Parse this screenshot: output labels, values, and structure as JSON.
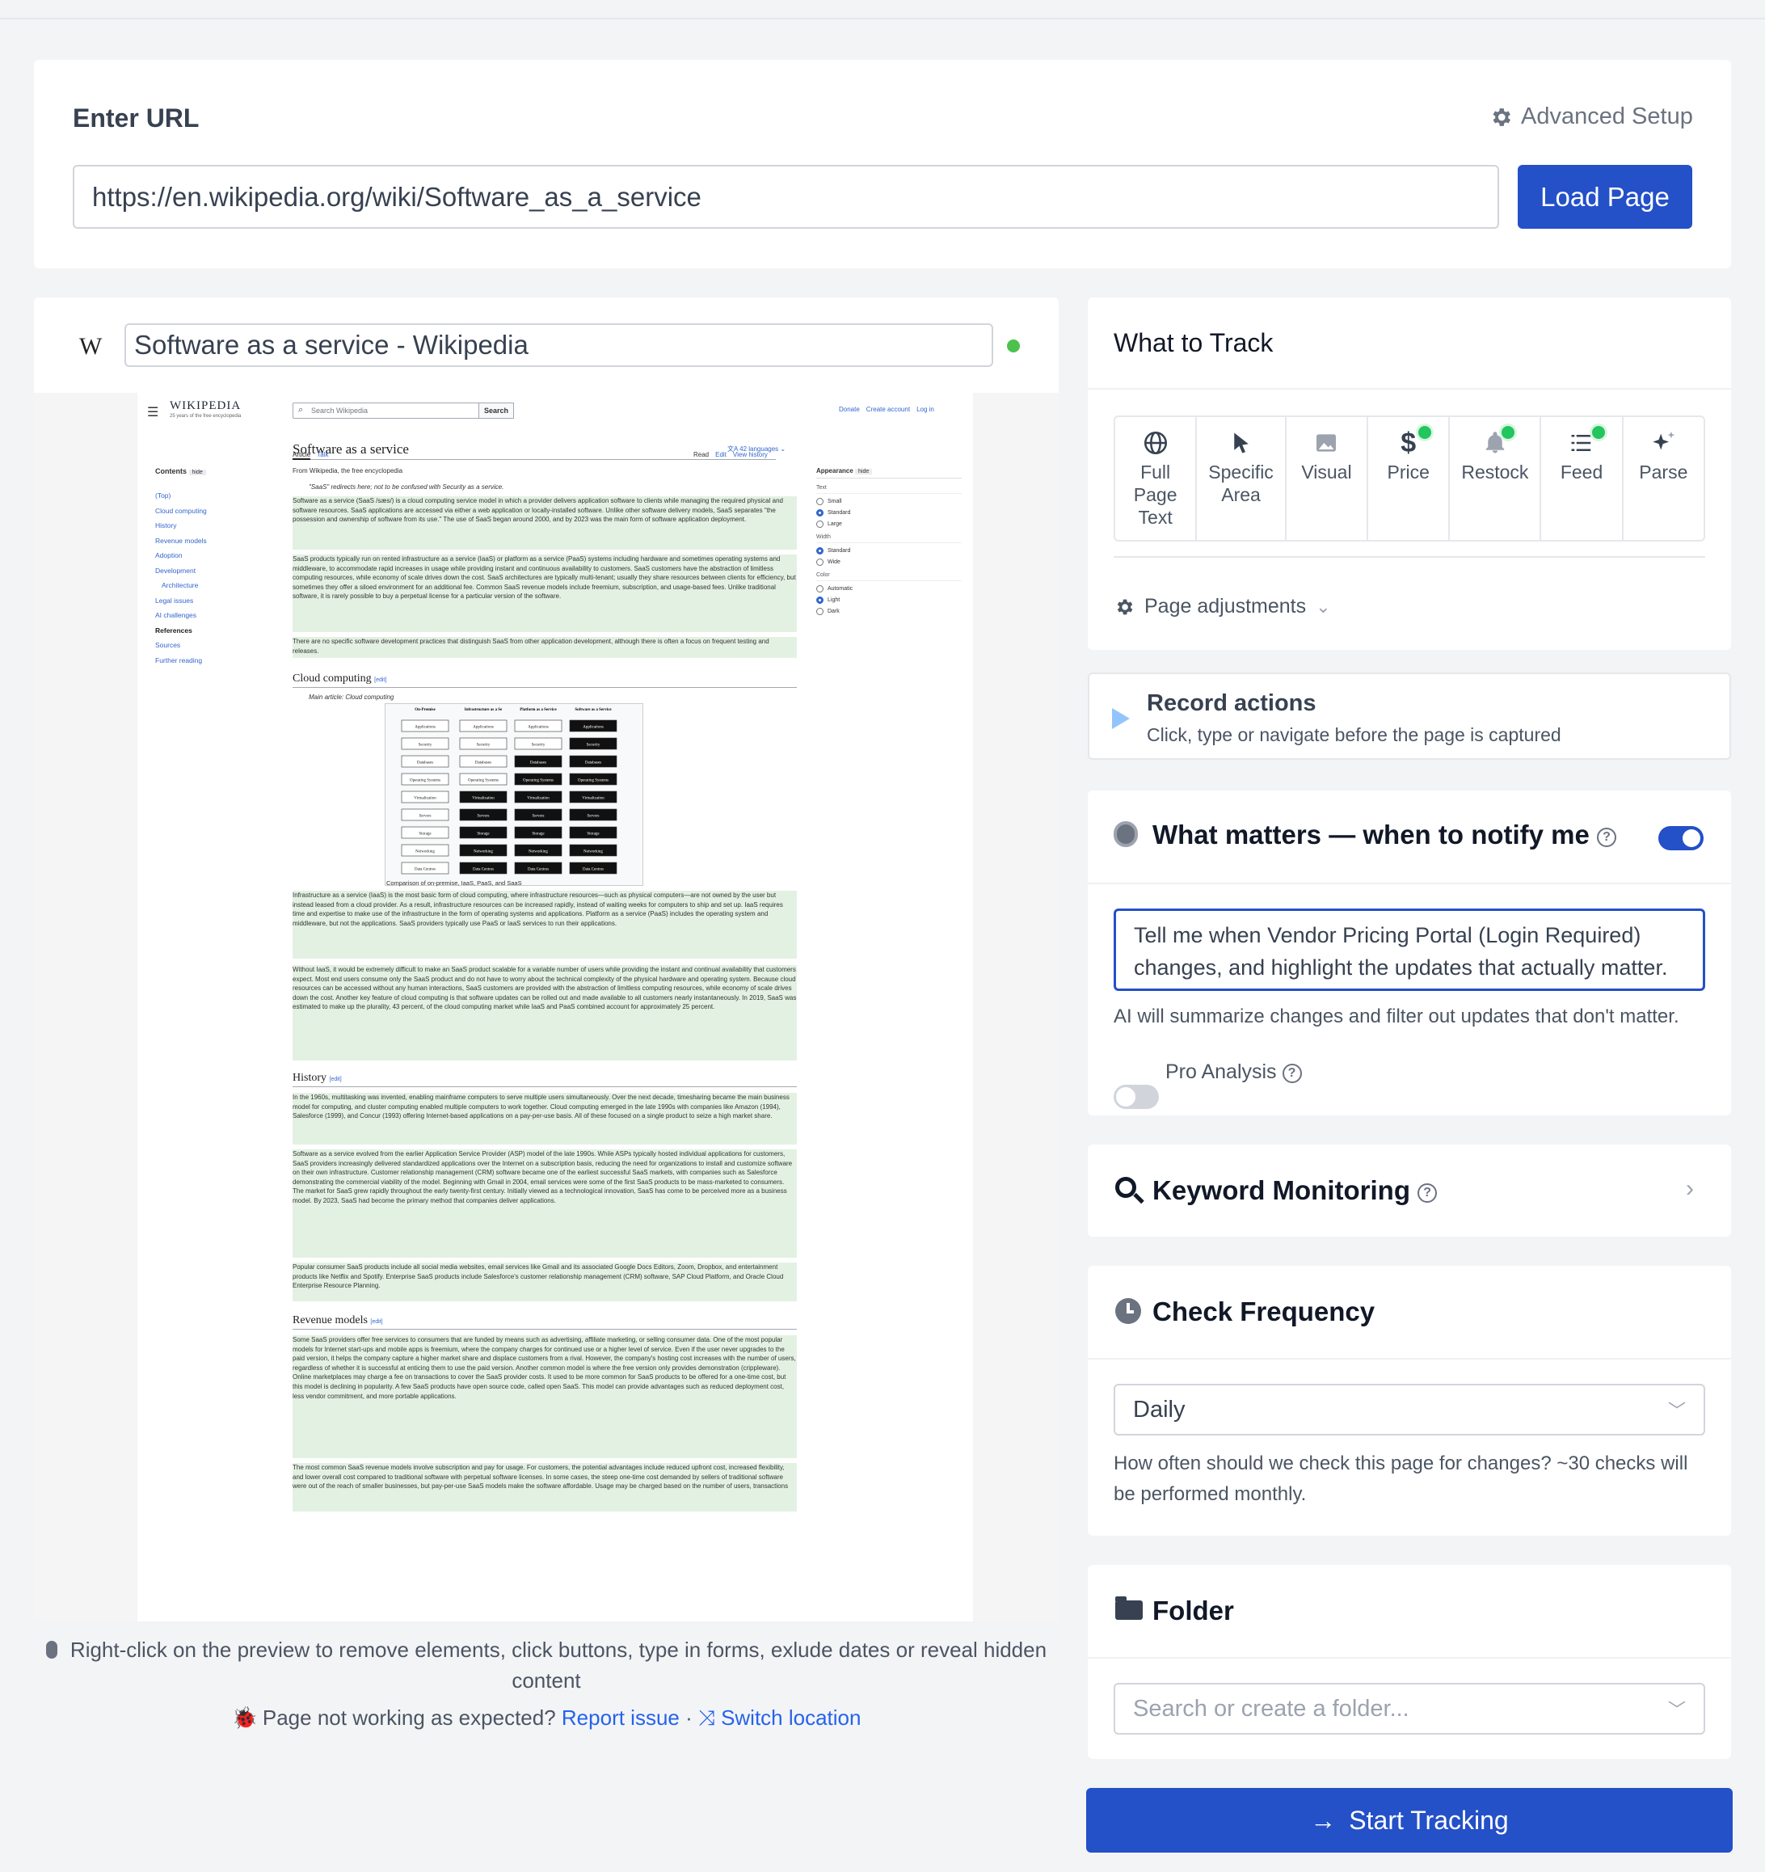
{
  "url_card": {
    "label": "Enter URL",
    "advanced_setup": "Advanced Setup",
    "url_value": "https://en.wikipedia.org/wiki/Software_as_a_service",
    "load_button": "Load Page"
  },
  "preview": {
    "site_icon": "W",
    "page_title": "Software as a service - Wikipedia",
    "status_color": "#4cc24c",
    "wiki": {
      "logo": "WIKIPEDIA",
      "logo_sub": "25 years of the free encyclopedia",
      "search_placeholder": "Search Wikipedia",
      "search_button": "Search",
      "top_links": [
        "Donate",
        "Create account",
        "Log in"
      ],
      "contents_label": "Contents",
      "hide": "hide",
      "toc": [
        "(Top)",
        "Cloud computing",
        "History",
        "Revenue models",
        "Adoption",
        "Development",
        "Architecture",
        "Legal issues",
        "AI challenges",
        "References",
        "Sources",
        "Further reading"
      ],
      "article_title": "Software as a service",
      "languages": "42 languages",
      "tabs_left": [
        "Article",
        "Talk"
      ],
      "tabs_right": [
        "Read",
        "Edit",
        "View history"
      ],
      "from": "From Wikipedia, the free encyclopedia",
      "hatnote": "\"SaaS\" redirects here; not to be confused with Security as a service.",
      "appearance_label": "Appearance",
      "appearance_groups": [
        {
          "name": "Text",
          "options": [
            "Small",
            "Standard",
            "Large"
          ],
          "selected": 1
        },
        {
          "name": "Width",
          "options": [
            "Standard",
            "Wide"
          ],
          "selected": 0
        },
        {
          "name": "Color",
          "options": [
            "Automatic",
            "Light",
            "Dark"
          ],
          "selected": 1
        }
      ],
      "sections": [
        "Cloud computing",
        "History",
        "Revenue models"
      ],
      "edit": "edit",
      "main_article": "Main article: Cloud computing",
      "diagram_caption": "Comparison of on-premise, IaaS, PaaS, and SaaS",
      "diagram_cols": [
        "On-Premise",
        "Infrastructure as a Service (IaaS)",
        "Platform as a Service (PaaS)",
        "Software as a Service (SaaS)"
      ],
      "diagram_rows": [
        "Applications",
        "Security",
        "Databases",
        "Operating Systems",
        "Virtualization",
        "Servers",
        "Storage",
        "Networking",
        "Data Centres"
      ],
      "intro_p": "Software as a service (SaaS /sæs/) is a cloud computing service model in which a provider delivers application software to clients while managing the required physical and software resources. SaaS applications are accessed via either a web application or locally-installed software. Unlike other software delivery models, SaaS separates \"the possession and ownership of software from its use.\" The use of SaaS began around 2000, and by 2023 was the main form of software application deployment.",
      "p2": "SaaS products typically run on rented infrastructure as a service (IaaS) or platform as a service (PaaS) systems including hardware and sometimes operating systems and middleware, to accommodate rapid increases in usage while providing instant and continuous availability to customers. SaaS customers have the abstraction of limitless computing resources, while economy of scale drives down the cost. SaaS architectures are typically multi-tenant; usually they share resources between clients for efficiency, but sometimes they offer a siloed environment for an additional fee. Common SaaS revenue models include freemium, subscription, and usage-based fees. Unlike traditional software, it is rarely possible to buy a perpetual license for a particular version of the software.",
      "p3": "There are no specific software development practices that distinguish SaaS from other application development, although there is often a focus on frequent testing and releases.",
      "p4": "Infrastructure as a service (IaaS) is the most basic form of cloud computing, where infrastructure resources—such as physical computers—are not owned by the user but instead leased from a cloud provider. As a result, infrastructure resources can be increased rapidly, instead of waiting weeks for computers to ship and set up. IaaS requires time and expertise to make use of the infrastructure in the form of operating systems and applications. Platform as a service (PaaS) includes the operating system and middleware, but not the applications. SaaS providers typically use PaaS or IaaS services to run their applications.",
      "p5": "Without IaaS, it would be extremely difficult to make an SaaS product scalable for a variable number of users while providing the instant and continual availability that customers expect. Most end users consume only the SaaS product and do not have to worry about the technical complexity of the physical hardware and operating system. Because cloud resources can be accessed without any human interactions, SaaS customers are provided with the abstraction of limitless computing resources, while economy of scale drives down the cost. Another key feature of cloud computing is that software updates can be rolled out and made available to all customers nearly instantaneously. In 2019, SaaS was estimated to make up the plurality, 43 percent, of the cloud computing market while IaaS and PaaS combined account for approximately 25 percent.",
      "p6": "In the 1960s, multitasking was invented, enabling mainframe computers to serve multiple users simultaneously. Over the next decade, timesharing became the main business model for computing, and cluster computing enabled multiple computers to work together. Cloud computing emerged in the late 1990s with companies like Amazon (1994), Salesforce (1999), and Concur (1993) offering Internet-based applications on a pay-per-use basis. All of these focused on a single product to seize a high market share.",
      "p7": "Software as a service evolved from the earlier Application Service Provider (ASP) model of the late 1990s. While ASPs typically hosted individual applications for customers, SaaS providers increasingly delivered standardized applications over the Internet on a subscription basis, reducing the need for organizations to install and customize software on their own infrastructure. Customer relationship management (CRM) software became one of the earliest successful SaaS markets, with companies such as Salesforce demonstrating the commercial viability of the model. Beginning with Gmail in 2004, email services were some of the first SaaS products to be mass-marketed to consumers. The market for SaaS grew rapidly throughout the early twenty-first century. Initially viewed as a technological innovation, SaaS has come to be perceived more as a business model. By 2023, SaaS had become the primary method that companies deliver applications.",
      "p8": "Popular consumer SaaS products include all social media websites, email services like Gmail and its associated Google Docs Editors, Zoom, Dropbox, and entertainment products like Netflix and Spotify. Enterprise SaaS products include Salesforce's customer relationship management (CRM) software, SAP Cloud Platform, and Oracle Cloud Enterprise Resource Planning.",
      "p9": "Some SaaS providers offer free services to consumers that are funded by means such as advertising, affiliate marketing, or selling consumer data. One of the most popular models for Internet start-ups and mobile apps is freemium, where the company charges for continued use or a higher level of service. Even if the user never upgrades to the paid version, it helps the company capture a higher market share and displace customers from a rival. However, the company's hosting cost increases with the number of users, regardless of whether it is successful at enticing them to use the paid version. Another common model is where the free version only provides demonstration (crippleware). Online marketplaces may charge a fee on transactions to cover the SaaS provider costs. It used to be more common for SaaS products to be offered for a one-time cost, but this model is declining in popularity. A few SaaS products have open source code, called open SaaS. This model can provide advantages such as reduced deployment cost, less vendor commitment, and more portable applications.",
      "p10": "The most common SaaS revenue models involve subscription and pay for usage. For customers, the potential advantages include reduced upfront cost, increased flexibility, and lower overall cost compared to traditional software with perpetual software licenses. In some cases, the steep one-time cost demanded by sellers of traditional software were out of the reach of smaller businesses, but pay-per-use SaaS models make the software affordable. Usage may be charged based on the number of users, transactions"
    },
    "help_text": "Right-click on the preview to remove elements, click buttons, type in forms, exlude dates or reveal hidden content",
    "issue_text": "Page not working as expected?",
    "report_link": "Report issue",
    "separator": "·",
    "switch_link": "Switch location"
  },
  "track": {
    "title": "What to Track",
    "options": [
      {
        "label": "Full Page Text",
        "icon": "globe-icon",
        "badge": false
      },
      {
        "label": "Specific Area",
        "icon": "cursor-icon",
        "badge": false
      },
      {
        "label": "Visual",
        "icon": "image-icon",
        "badge": false
      },
      {
        "label": "Price",
        "icon": "dollar-icon",
        "badge": true
      },
      {
        "label": "Restock",
        "icon": "bell-icon",
        "badge": true
      },
      {
        "label": "Feed",
        "icon": "list-icon",
        "badge": true
      },
      {
        "label": "Parse",
        "icon": "sparkle-icon",
        "badge": false
      }
    ],
    "badge_color": "#22c55e",
    "page_adjustments": "Page adjustments"
  },
  "record": {
    "title": "Record actions",
    "subtitle": "Click, type or navigate before the page is captured"
  },
  "notify": {
    "title": "What matters — when to notify me",
    "enabled": true,
    "prompt": "Tell me when Vendor Pricing Portal (Login Required) changes, and highlight the updates that actually matter.",
    "hint": "AI will summarize changes and filter out updates that don't matter.",
    "pro_label": "Pro Analysis",
    "pro_enabled": false
  },
  "keyword": {
    "title": "Keyword Monitoring"
  },
  "frequency": {
    "title": "Check Frequency",
    "value": "Daily",
    "hint": "How often should we check this page for changes? ~30 checks will be performed monthly."
  },
  "folder": {
    "title": "Folder",
    "placeholder": "Search or create a folder..."
  },
  "start_button": "Start Tracking",
  "accent": "#2450c8"
}
